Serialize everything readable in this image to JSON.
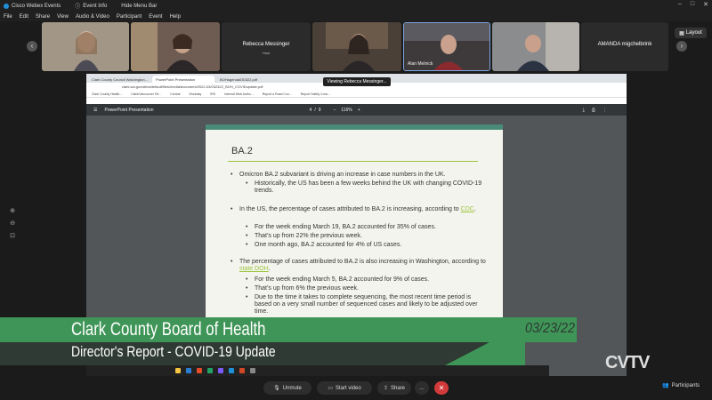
{
  "titlebar": {
    "app": "Cisco Webex Events",
    "event_info": "Event Info",
    "hide_menu": "Hide Menu Bar"
  },
  "menu": [
    "File",
    "Edit",
    "Share",
    "View",
    "Audio & Video",
    "Participant",
    "Event",
    "Help"
  ],
  "participants": {
    "host_name": "Rebecca Messinger",
    "host_role": "Host",
    "alan": "Alan Melnick",
    "amanda": "AMANDA migchelbrink"
  },
  "layout_label": "Layout",
  "viewing_label": "Viewing Rebecca Messinger...",
  "browser": {
    "tabs": [
      "Clark County Council Washington...",
      "PowerPoint Presentation",
      "BOHagenda030322.pdf"
    ],
    "address": "clark.wa.gov/sites/default/files/media/document/2022-03/032322_BOH_COVIDupdate.pdf",
    "bookmarks": [
      "Clark County Health...",
      "Clark/Vancouver Tel...",
      "Central",
      "Workday",
      "IRS",
      "Internal Web Autho...",
      "Report a Road Con...",
      "Report Safety Conc..."
    ]
  },
  "pdf": {
    "title": "PowerPoint Presentation",
    "page": "4",
    "pages": "9",
    "zoom": "116%"
  },
  "slide": {
    "heading": "BA.2",
    "b1": "Omicron BA.2 subvariant is driving an increase in case numbers in the UK.",
    "b1a": "Historically, the US has been a few weeks behind the UK with changing COVID-19 trends.",
    "b2_pre": "In the US, the percentage of cases attributed to BA.2 is increasing, according to ",
    "b2_link": "CDC",
    "b2a": "For the week ending March 19, BA.2 accounted for 35% of cases.",
    "b2b": "That’s up from 22% the previous week.",
    "b2c": "One month ago, BA.2 accounted for 4% of US cases.",
    "b3_pre": "The percentage of cases attributed to BA.2 is also increasing in Washington, according to ",
    "b3_link": "state DOH",
    "b3a": "For the week ending March 5, BA.2 accounted for 9% of cases.",
    "b3b": "That’s up from 6% the previous week.",
    "b3c": "Due to the time it takes to complete sequencing, the most recent time period is based on a very small number of sequenced cases and likely to be adjusted over time."
  },
  "lower_third": {
    "title": "Clark County Board of Health",
    "subtitle": "Director's Report - COVID-19 Update",
    "date": "03/23/22"
  },
  "logo": "CVTV",
  "controls": {
    "unmute": "Unmute",
    "start_video": "Start video",
    "share": "Share",
    "participants": "Participants"
  },
  "colors": {
    "accent_green": "#3f9557",
    "slide_rule": "#9bc53d",
    "end_red": "#d23a3a"
  }
}
